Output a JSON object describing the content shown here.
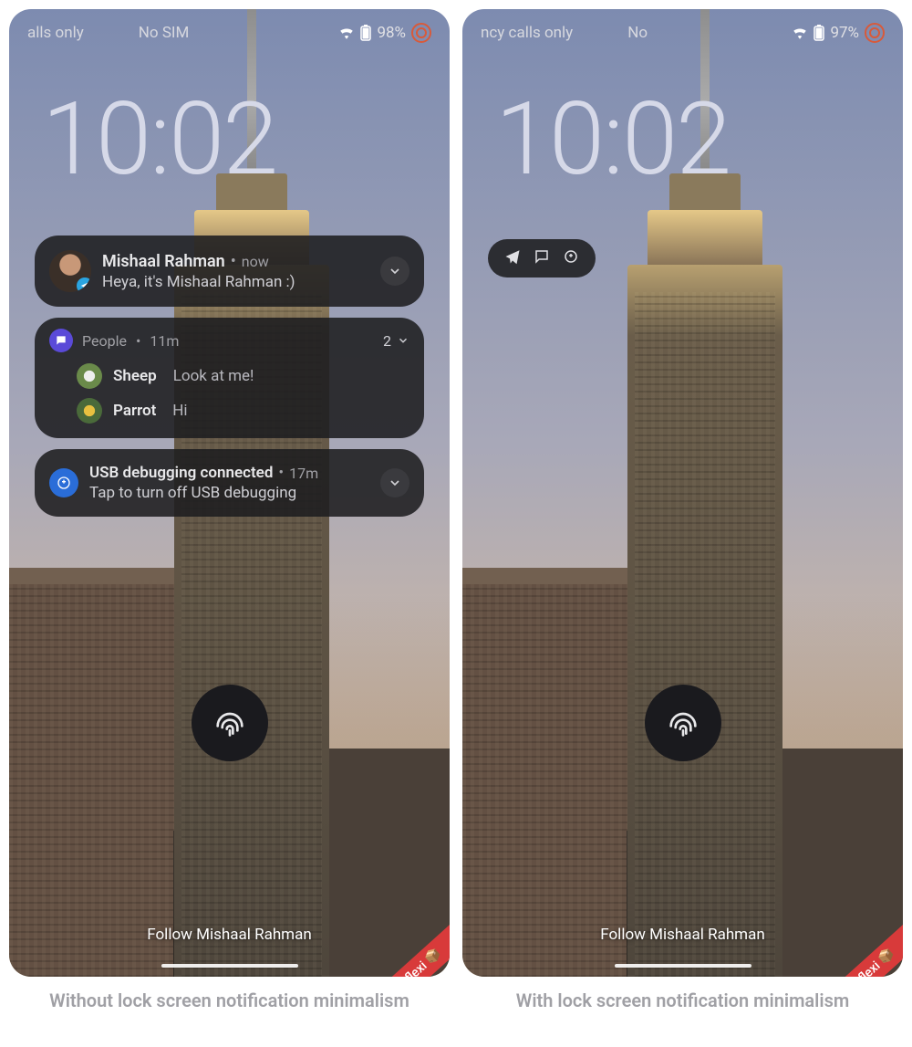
{
  "left": {
    "statusbar": {
      "carrier_left": "alls only",
      "carrier_center": "No SIM",
      "battery": "98%"
    },
    "clock": "10:02",
    "notif1": {
      "title": "Mishaal Rahman",
      "time": "now",
      "message": "Heya, it's Mishaal Rahman :)"
    },
    "notif2": {
      "app": "People",
      "time": "11m",
      "count": "2",
      "conversations": [
        {
          "name": "Sheep",
          "message": "Look at me!"
        },
        {
          "name": "Parrot",
          "message": "Hi"
        }
      ]
    },
    "notif3": {
      "title": "USB debugging connected",
      "time": "17m",
      "message": "Tap to turn off USB debugging"
    },
    "watermark": "Follow Mishaal Rahman",
    "ribbon": "flexi 📦",
    "caption": "Without lock screen notification minimalism"
  },
  "right": {
    "statusbar": {
      "carrier_left": "ncy calls only",
      "carrier_center": "No",
      "battery": "97%"
    },
    "clock": "10:02",
    "watermark": "Follow Mishaal Rahman",
    "ribbon": "flexi 📦",
    "caption": "With lock screen notification minimalism"
  }
}
